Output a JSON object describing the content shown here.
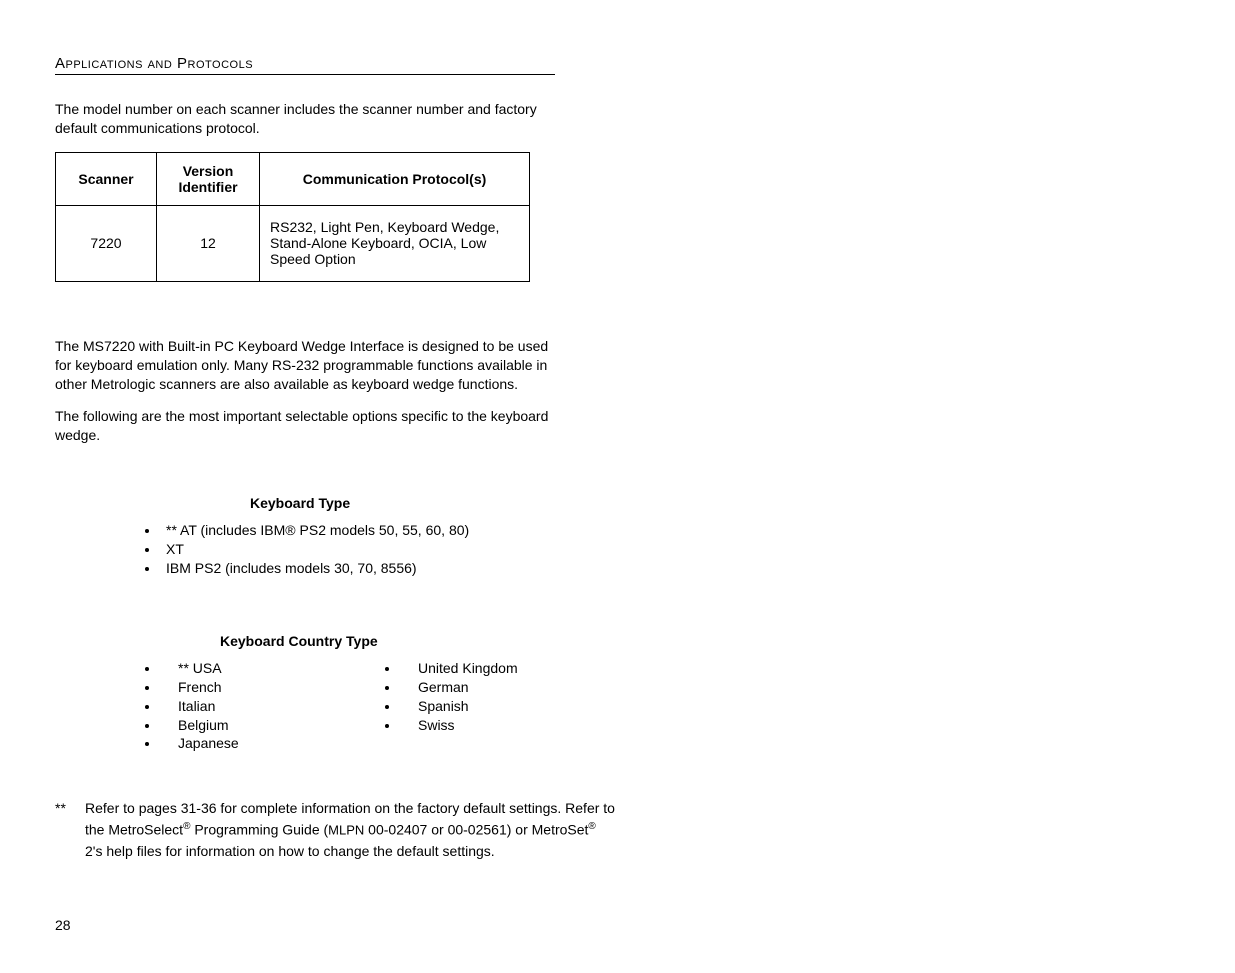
{
  "title": "Applications and Protocols",
  "intro": "The model number on each scanner includes the scanner number and factory default communications protocol.",
  "table": {
    "headers": {
      "c1": "Scanner",
      "c2": "Version Identifier",
      "c3": "Communication Protocol(s)"
    },
    "row": {
      "scanner": "7220",
      "version": "12",
      "protocols": "RS232, Light Pen, Keyboard Wedge, Stand-Alone Keyboard, OCIA, Low Speed Option"
    }
  },
  "para1": "The MS7220 with Built-in PC Keyboard Wedge Interface is designed to be used for keyboard emulation only. Many RS-232 programmable functions available in other Metrologic scanners are also available as keyboard wedge functions.",
  "para2": "The following are the most important selectable options specific to the keyboard wedge.",
  "kbType": {
    "heading": "Keyboard Type",
    "items": [
      "** AT (includes IBM® PS2 models 50, 55, 60, 80)",
      "XT",
      "IBM PS2 (includes models 30, 70, 8556)"
    ]
  },
  "kbCountry": {
    "heading": "Keyboard Country Type",
    "col1": [
      "** USA",
      "French",
      "Italian",
      "Belgium",
      "Japanese"
    ],
    "col2": [
      "United Kingdom",
      "German",
      "Spanish",
      "Swiss"
    ]
  },
  "footnote": {
    "marker": "**",
    "line1a": "Refer to pages 31-36 for complete information on the factory default settings.  Refer to the MetroSelect",
    "line1b": " Programming Guide (",
    "mlpn": "MLPN",
    "line1c": " 00-02407 or 00-02561) or MetroSet",
    "line1d": " 2's help files for information on how to change the default settings."
  },
  "pageNumber": "28"
}
